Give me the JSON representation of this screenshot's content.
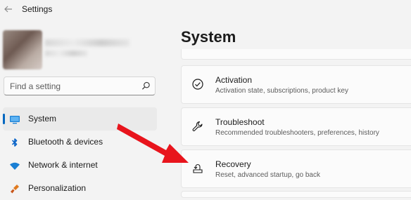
{
  "window": {
    "title": "Settings"
  },
  "search": {
    "placeholder": "Find a setting"
  },
  "sidebar": {
    "items": [
      {
        "label": "System",
        "icon": "monitor-icon",
        "active": true
      },
      {
        "label": "Bluetooth & devices",
        "icon": "bluetooth-icon"
      },
      {
        "label": "Network & internet",
        "icon": "wifi-icon"
      },
      {
        "label": "Personalization",
        "icon": "paintbrush-icon"
      }
    ]
  },
  "main": {
    "title": "System",
    "cards": [
      {
        "title": "Activation",
        "desc": "Activation state, subscriptions, product key",
        "icon": "check-circle-icon"
      },
      {
        "title": "Troubleshoot",
        "desc": "Recommended troubleshooters, preferences, history",
        "icon": "wrench-icon"
      },
      {
        "title": "Recovery",
        "desc": "Reset, advanced startup, go back",
        "icon": "recovery-icon"
      }
    ]
  },
  "colors": {
    "accent": "#0067c0",
    "annotation_arrow": "#e8141c",
    "background": "#f3f3f3"
  }
}
